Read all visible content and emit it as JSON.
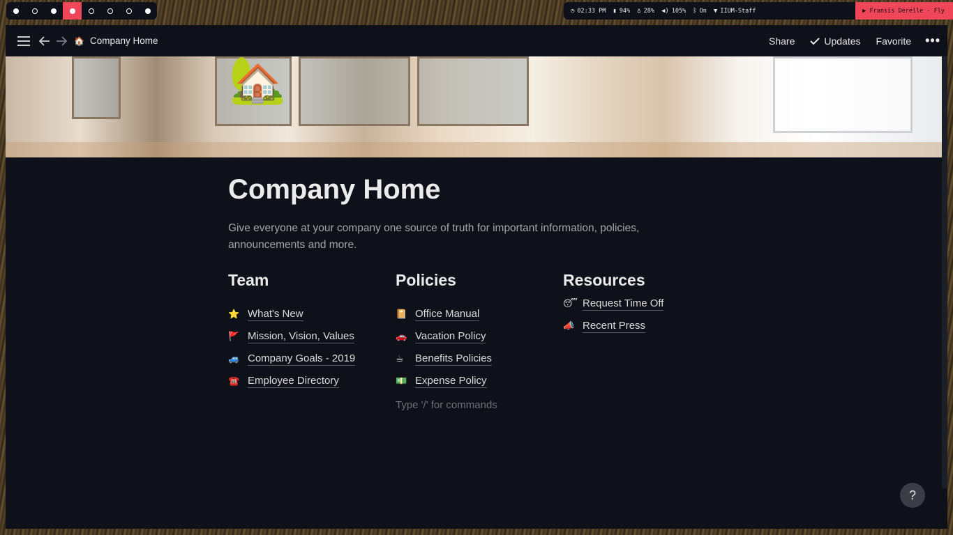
{
  "statusbar": {
    "workspaces": [
      {
        "state": "filled"
      },
      {
        "state": "hollow"
      },
      {
        "state": "filled"
      },
      {
        "state": "active"
      },
      {
        "state": "hollow"
      },
      {
        "state": "hollow"
      },
      {
        "state": "hollow"
      },
      {
        "state": "filled"
      }
    ],
    "time": "02:33 PM",
    "battery": "94%",
    "brightness": "28%",
    "volume": "105%",
    "bluetooth": "On",
    "wifi": "IIUM-Staff",
    "media": "Fransis Derelle - Fly",
    "accent": "#f0465a"
  },
  "topbar": {
    "page_emoji": "🏠",
    "breadcrumb": "Company Home",
    "share": "Share",
    "updates": "Updates",
    "favorite": "Favorite",
    "more": "•••"
  },
  "page": {
    "icon": "🏡",
    "title": "Company Home",
    "description": "Give everyone at your company one source of truth for important information, policies, announcements and more.",
    "columns": [
      {
        "heading": "Team",
        "items": [
          {
            "emoji": "⭐",
            "label": "What's New"
          },
          {
            "emoji": "🚩",
            "label": "Mission, Vision, Values"
          },
          {
            "emoji": "🚙",
            "label": "Company Goals - 2019"
          },
          {
            "emoji": "☎️",
            "label": "Employee Directory"
          }
        ]
      },
      {
        "heading": "Policies",
        "items": [
          {
            "emoji": "📔",
            "label": "Office Manual"
          },
          {
            "emoji": "🚗",
            "label": "Vacation Policy"
          },
          {
            "emoji": "☕",
            "label": "Benefits Policies"
          },
          {
            "emoji": "💵",
            "label": "Expense Policy"
          }
        ],
        "placeholder": "Type '/' for commands"
      },
      {
        "heading": "Resources",
        "items": [
          {
            "emoji": "😴",
            "label": "Request Time Off"
          },
          {
            "emoji": "📣",
            "label": "Recent Press"
          }
        ]
      }
    ]
  },
  "help": "?"
}
